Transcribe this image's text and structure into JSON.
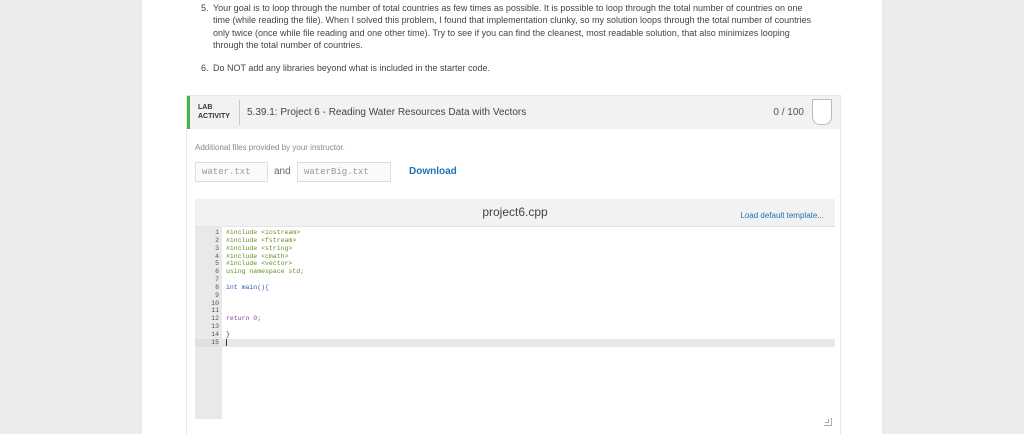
{
  "instructions": [
    {
      "num": "5.",
      "text": "Your goal is to loop through the number of total countries as few times as possible. It is possible to loop through the total number of countries on one time (while reading the file). When I solved this problem, I found that implementation clunky, so my solution loops through the total number of countries only twice (once while file reading and one other time). Try to see if you can find the cleanest, most readable solution, that also minimizes looping through the total number of countries."
    },
    {
      "num": "6.",
      "text": "Do NOT add any libraries beyond what is included in the starter code."
    }
  ],
  "lab": {
    "tag_line1": "LAB",
    "tag_line2": "ACTIVITY",
    "title": "5.39.1: Project 6 - Reading Water Resources Data with Vectors",
    "score": "0 / 100",
    "accent_color": "#4caf50"
  },
  "files": {
    "caption": "Additional files provided by your instructor.",
    "file1": "water.txt",
    "and": "and",
    "file2": "waterBig.txt",
    "download_label": "Download"
  },
  "editor": {
    "filename": "project6.cpp",
    "load_template_label": "Load default template...",
    "lines": [
      {
        "n": "1",
        "code": "#include <iostream>"
      },
      {
        "n": "2",
        "code": "#include <fstream>"
      },
      {
        "n": "3",
        "code": "#include <string>"
      },
      {
        "n": "4",
        "code": "#include <cmath>"
      },
      {
        "n": "5",
        "code": "#include <vector>"
      },
      {
        "n": "6",
        "code": "using namespace std;"
      },
      {
        "n": "7",
        "code": ""
      },
      {
        "n": "8",
        "code": "int main(){"
      },
      {
        "n": "9",
        "code": ""
      },
      {
        "n": "10",
        "code": ""
      },
      {
        "n": "11",
        "code": ""
      },
      {
        "n": "12",
        "code": "return 0;"
      },
      {
        "n": "13",
        "code": ""
      },
      {
        "n": "14",
        "code": "}"
      },
      {
        "n": "15",
        "code": ""
      }
    ],
    "active_line": "15"
  }
}
